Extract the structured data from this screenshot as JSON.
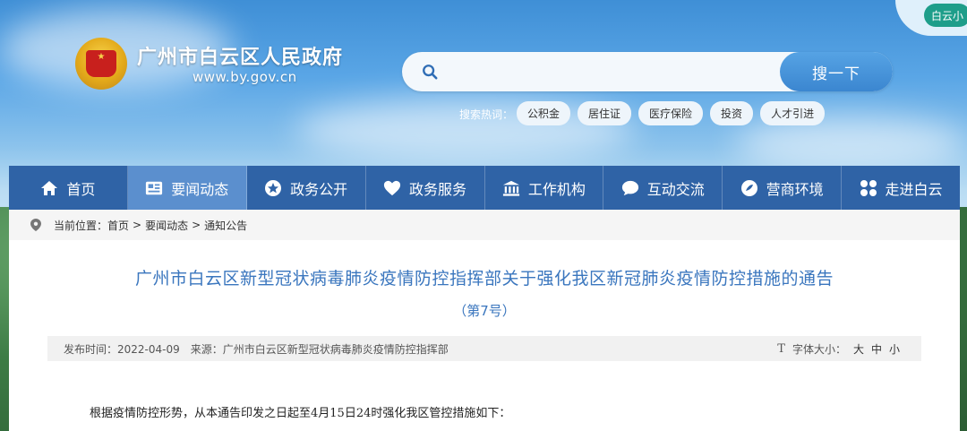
{
  "header": {
    "site_title": "广州市白云区人民政府",
    "site_domain": "www.by.gov.cn",
    "search": {
      "placeholder": "",
      "button_label": "搜一下"
    },
    "hot_label": "搜索热词：",
    "hot_tags": [
      "公积金",
      "居住证",
      "医疗保险",
      "投资",
      "人才引进"
    ],
    "corner_badge": "白云小"
  },
  "nav": {
    "items": [
      {
        "label": "首页",
        "icon": "home-icon",
        "active": false
      },
      {
        "label": "要闻动态",
        "icon": "news-icon",
        "active": true
      },
      {
        "label": "政务公开",
        "icon": "star-icon",
        "active": false
      },
      {
        "label": "政务服务",
        "icon": "heart-icon",
        "active": false
      },
      {
        "label": "工作机构",
        "icon": "building-icon",
        "active": false
      },
      {
        "label": "互动交流",
        "icon": "chat-icon",
        "active": false
      },
      {
        "label": "营商环境",
        "icon": "compass-icon",
        "active": false
      },
      {
        "label": "走进白云",
        "icon": "grid-icon",
        "active": false
      }
    ]
  },
  "breadcrumb": {
    "prefix": "当前位置：",
    "items": [
      "首页",
      "要闻动态",
      "通知公告"
    ],
    "separator": ">"
  },
  "article": {
    "title": "广州市白云区新型冠状病毒肺炎疫情防控指挥部关于强化我区新冠肺炎疫情防控措施的通告",
    "subtitle": "（第7号）",
    "meta": {
      "date": "发布时间：2022-04-09",
      "source": "来源：广州市白云区新型冠状病毒肺炎疫情防控指挥部",
      "font_label": "字体大小：",
      "font_sizes": [
        "大",
        "中",
        "小"
      ]
    },
    "body_first_line": "根据疫情防控形势，从本通告印发之日起至4月15日24时强化我区管控措施如下："
  },
  "colors": {
    "nav_bg": "#2f63a6",
    "nav_active": "#5b8fce",
    "title_blue": "#3a76be",
    "search_button": "#3b86d0"
  }
}
